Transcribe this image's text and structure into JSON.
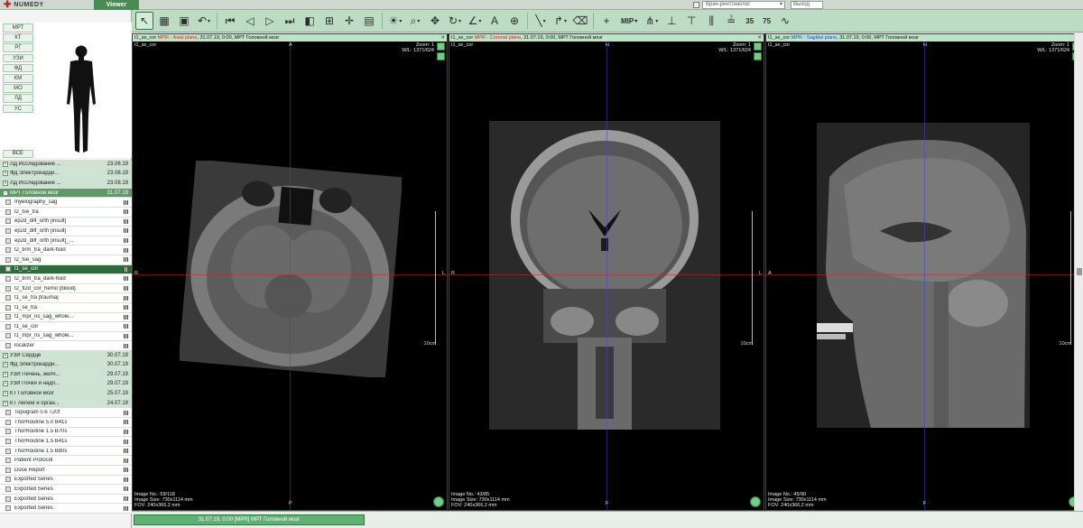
{
  "app": {
    "logo": "NUMEDY",
    "viewer_tab": "Viewer"
  },
  "user": {
    "role": "Врач-рентгенолог",
    "exit": "Выход"
  },
  "toolbar": {
    "mip_label": "MIP",
    "pct35": "35",
    "pct75": "75"
  },
  "modalities": [
    "МРТ",
    "КТ",
    "РГ",
    "УЗИ",
    "ФД",
    "КМ",
    "МО",
    "ЛД",
    "УС"
  ],
  "all_label": "ВСЕ",
  "studies": [
    {
      "kind": "study",
      "name": "ЛД Исследование ...",
      "date": "23.08.19"
    },
    {
      "kind": "study",
      "name": "ФД Электрокарди...",
      "date": "23.08.19"
    },
    {
      "kind": "study",
      "name": "ЛД Исследование ...",
      "date": "23.08.19"
    },
    {
      "kind": "study",
      "active": true,
      "name": "МРТ Головной мозг",
      "date": "31.07.19"
    },
    {
      "kind": "series",
      "name": "myelography_sag"
    },
    {
      "kind": "series",
      "name": "t2_tse_tra"
    },
    {
      "kind": "series",
      "name": "ep2d_diff_orth [insult]"
    },
    {
      "kind": "series",
      "name": "ep2d_diff_orth [insult]"
    },
    {
      "kind": "series",
      "name": "ep2d_diff_orth [insult]_..."
    },
    {
      "kind": "series",
      "name": "t2_tirm_tra_dark-fluid"
    },
    {
      "kind": "series",
      "name": "t2_tse_sag"
    },
    {
      "kind": "series",
      "sel": true,
      "name": "t1_se_cor"
    },
    {
      "kind": "series",
      "name": "t2_tirm_tra_dark-fluid"
    },
    {
      "kind": "series",
      "name": "t2_fl2d_cor_hemo [blood]"
    },
    {
      "kind": "series",
      "name": "t1_se_tra [trauma]"
    },
    {
      "kind": "series",
      "name": "t1_se_tra"
    },
    {
      "kind": "series",
      "name": "t1_mpr_ns_sag_whole..."
    },
    {
      "kind": "series",
      "name": "t1_se_cor"
    },
    {
      "kind": "series",
      "name": "t1_mpr_ns_sag_whole..."
    },
    {
      "kind": "series",
      "name": "localizer"
    },
    {
      "kind": "study",
      "name": "УЗИ Сердце",
      "date": "30.07.19"
    },
    {
      "kind": "study",
      "name": "ФД Электрокарди...",
      "date": "30.07.19"
    },
    {
      "kind": "study",
      "name": "УЗИ Печень, желч...",
      "date": "29.07.19"
    },
    {
      "kind": "study",
      "name": "УЗИ Почки и надп...",
      "date": "29.07.19"
    },
    {
      "kind": "study",
      "name": "КТ Головной мозг",
      "date": "25.07.19"
    },
    {
      "kind": "study",
      "name": "КТ Легкие и орган...",
      "date": "24.07.19"
    },
    {
      "kind": "series",
      "name": "Topogram 0.6 T20f"
    },
    {
      "kind": "series",
      "name": "ThorRoutine 5.0 B41s"
    },
    {
      "kind": "series",
      "name": "ThorRoutine 1.5 B70s"
    },
    {
      "kind": "series",
      "name": "ThorRoutine 1.5 B41s"
    },
    {
      "kind": "series",
      "name": "ThorRoutine 1.5 B80s"
    },
    {
      "kind": "series",
      "name": "Patient Protocol"
    },
    {
      "kind": "series",
      "name": "Dose Report"
    },
    {
      "kind": "series",
      "name": "Exported Series"
    },
    {
      "kind": "series",
      "name": "Exported Series"
    },
    {
      "kind": "series",
      "name": "Exported Series"
    },
    {
      "kind": "series",
      "name": "Exported Series"
    }
  ],
  "viewports": [
    {
      "header_series": "t1_se_cor",
      "header_plane": "MPR - Axial plane",
      "header_rest": ", 31.07.19, 0:00, МРТ Головной мозг",
      "tl": "t1_se_cor",
      "zoom": "Zoom: 1",
      "wl": "W/L: 1371/624",
      "top": "A",
      "bottom": "P",
      "left": "R",
      "right": "L",
      "scale": "10cm",
      "img_no": "Image No.: 59/118",
      "img_size": "Image Size: 730x1114 mm",
      "fov": "FOV: 240x366,2 mm"
    },
    {
      "header_series": "t1_se_cor",
      "header_plane": "MPR - Coronal plane",
      "header_rest": ", 31.07.19, 0:00, МРТ Головной мозг",
      "tl": "t1_se_cor",
      "zoom": "Zoom: 1",
      "wl": "W/L: 1371/624",
      "top": "H",
      "bottom": "F",
      "left": "R",
      "right": "L",
      "scale": "10cm",
      "img_no": "Image No.: 43/85",
      "img_size": "Image Size: 730x1114 mm",
      "fov": "FOV: 240x366,2 mm"
    },
    {
      "header_series": "t1_se_cor",
      "header_plane": "MPR - Sagittal plane",
      "header_rest": ", 31.07.19, 0:00, МРТ Головной мозг",
      "tl": "t1_se_cor",
      "zoom": "Zoom: 1",
      "wl": "W/L: 1371/624",
      "top": "H",
      "bottom": "F",
      "left": "A",
      "right": "P",
      "scale": "10cm",
      "img_no": "Image No.: 45/90",
      "img_size": "Image Size: 730x1114 mm",
      "fov": "FOV: 240x366,2 mm"
    }
  ],
  "status": {
    "tab": "31.07.19, 0:00 [MPR] МРТ Головной мозг"
  }
}
